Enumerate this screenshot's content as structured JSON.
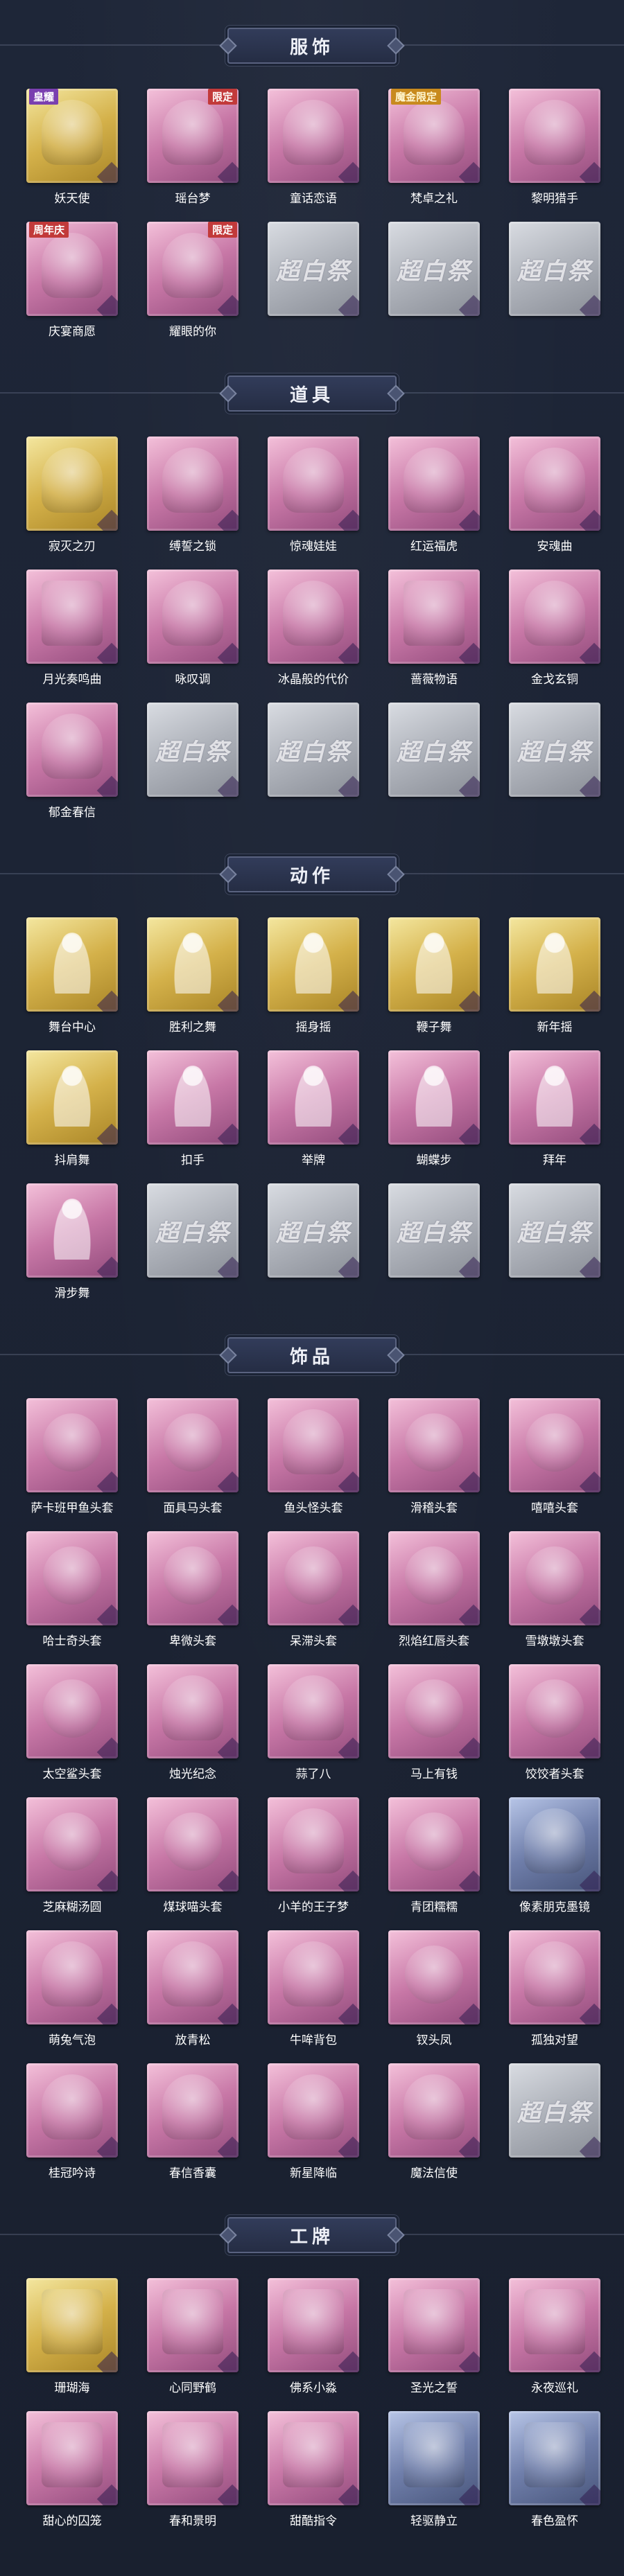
{
  "sections": [
    {
      "title": "服饰",
      "items": [
        {
          "label": "妖天使",
          "tag": "皇耀",
          "art": "figure-portrait"
        },
        {
          "label": "瑶台梦",
          "tag": "限定",
          "art": "figure-portrait"
        },
        {
          "label": "童话恋语",
          "art": "figure-portrait"
        },
        {
          "label": "梵卓之礼",
          "tag": "魔金限定",
          "art": "figure-portrait"
        },
        {
          "label": "黎明猎手",
          "art": "figure-portrait"
        },
        {
          "label": "庆宴商愿",
          "tag": "周年庆",
          "art": "figure-portrait"
        },
        {
          "label": "耀眼的你",
          "tag": "限定",
          "art": "figure-portrait"
        },
        {
          "watermark": "超白祭"
        },
        {
          "watermark": "超白祭"
        },
        {
          "watermark": "超白祭"
        }
      ]
    },
    {
      "title": "道具",
      "items": [
        {
          "label": "寂灭之刃",
          "art": "blade-icon"
        },
        {
          "label": "缚誓之锁",
          "art": "chain-icon"
        },
        {
          "label": "惊魂娃娃",
          "art": "doll-icon"
        },
        {
          "label": "红运福虎",
          "art": "tiger-icon"
        },
        {
          "label": "安魂曲",
          "art": "knife-icon"
        },
        {
          "label": "月光奏鸣曲",
          "art": "piano-icon"
        },
        {
          "label": "咏叹调",
          "art": "ornament-icon"
        },
        {
          "label": "冰晶般的代价",
          "art": "crystal-flower-icon"
        },
        {
          "label": "蔷薇物语",
          "art": "kit-icon"
        },
        {
          "label": "金戈玄铜",
          "art": "lantern-icon"
        },
        {
          "label": "郁金春信",
          "art": "fan-icon"
        },
        {
          "watermark": "超白祭"
        },
        {
          "watermark": "超白祭"
        },
        {
          "watermark": "超白祭"
        },
        {
          "watermark": "超白祭"
        }
      ]
    },
    {
      "title": "动作",
      "items": [
        {
          "label": "舞台中心",
          "art": "dance-icon"
        },
        {
          "label": "胜利之舞",
          "art": "dance-icon"
        },
        {
          "label": "摇身摇",
          "art": "dance-icon"
        },
        {
          "label": "鞭子舞",
          "art": "dance-icon"
        },
        {
          "label": "新年摇",
          "art": "dance-icon"
        },
        {
          "label": "抖肩舞",
          "art": "dance-icon"
        },
        {
          "label": "扣手",
          "art": "gesture-icon"
        },
        {
          "label": "举牌",
          "art": "gesture-icon"
        },
        {
          "label": "蝴蝶步",
          "art": "gesture-icon"
        },
        {
          "label": "拜年",
          "art": "gesture-icon"
        },
        {
          "label": "滑步舞",
          "art": "dance-icon"
        },
        {
          "watermark": "超白祭"
        },
        {
          "watermark": "超白祭"
        },
        {
          "watermark": "超白祭"
        },
        {
          "watermark": "超白祭"
        }
      ]
    },
    {
      "title": "饰品",
      "items": [
        {
          "label": "萨卡班甲鱼头套",
          "art": "fish-head-icon"
        },
        {
          "label": "面具马头套",
          "art": "horse-head-icon"
        },
        {
          "label": "鱼头怪头套",
          "art": "fish-monster-icon"
        },
        {
          "label": "滑稽头套",
          "art": "emoji-icon"
        },
        {
          "label": "嘻嘻头套",
          "art": "emoji-icon"
        },
        {
          "label": "哈士奇头套",
          "art": "dog-head-icon"
        },
        {
          "label": "卑微头套",
          "art": "emoji-icon"
        },
        {
          "label": "呆滞头套",
          "art": "emoji-icon"
        },
        {
          "label": "烈焰红唇头套",
          "art": "mouse-head-icon"
        },
        {
          "label": "雪墩墩头套",
          "art": "snowman-icon"
        },
        {
          "label": "太空鲨头套",
          "art": "shark-head-icon"
        },
        {
          "label": "烛光纪念",
          "art": "candle-icon"
        },
        {
          "label": "蒜了八",
          "art": "garlic-icon"
        },
        {
          "label": "马上有钱",
          "art": "bird-head-icon"
        },
        {
          "label": "饺饺者头套",
          "art": "dumpling-icon"
        },
        {
          "label": "芝麻糊汤圆",
          "art": "tangyuan-icon"
        },
        {
          "label": "煤球喵头套",
          "art": "cat-head-icon"
        },
        {
          "label": "小羊的王子梦",
          "art": "sheep-icon"
        },
        {
          "label": "青团糯糯",
          "art": "qingtuan-icon"
        },
        {
          "label": "像素朋克墨镜",
          "art": "sunglasses-icon"
        },
        {
          "label": "萌兔气泡",
          "art": "bubble-icon"
        },
        {
          "label": "放青松",
          "art": "bonsai-icon"
        },
        {
          "label": "牛哞背包",
          "art": "backpack-icon"
        },
        {
          "label": "钗头凤",
          "art": "headdress-icon"
        },
        {
          "label": "孤独对望",
          "art": "figure-icon"
        },
        {
          "label": "桂冠吟诗",
          "art": "pendant-icon"
        },
        {
          "label": "春信香囊",
          "art": "sachet-icon"
        },
        {
          "label": "新星降临",
          "art": "charm-icon"
        },
        {
          "label": "魔法信使",
          "art": "mouse-charm-icon"
        },
        {
          "watermark": "超白祭"
        }
      ]
    },
    {
      "title": "工牌",
      "items": [
        {
          "label": "珊瑚海",
          "art": "badge-frame-icon"
        },
        {
          "label": "心同野鹤",
          "art": "badge-frame-icon"
        },
        {
          "label": "佛系小淼",
          "art": "badge-frame-icon"
        },
        {
          "label": "圣光之誓",
          "art": "badge-frame-icon"
        },
        {
          "label": "永夜巡礼",
          "art": "badge-frame-icon"
        },
        {
          "label": "甜心的囚笼",
          "art": "badge-frame-icon"
        },
        {
          "label": "春和景明",
          "art": "badge-frame-icon"
        },
        {
          "label": "甜酷指令",
          "art": "badge-frame-icon"
        },
        {
          "label": "轻驱静立",
          "art": "badge-frame-icon"
        },
        {
          "label": "春色盈怀",
          "art": "badge-frame-icon"
        }
      ]
    }
  ]
}
